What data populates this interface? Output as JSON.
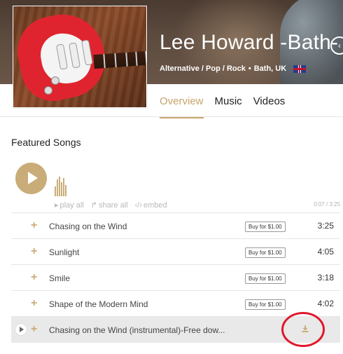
{
  "artist": {
    "name": "Lee Howard -Bath-",
    "genres": "Alternative / Pop / Rock",
    "separator": "•",
    "location": "Bath, UK"
  },
  "tabs": [
    {
      "label": "Overview",
      "active": true
    },
    {
      "label": "Music",
      "active": false
    },
    {
      "label": "Videos",
      "active": false
    }
  ],
  "featured": {
    "title": "Featured Songs",
    "actions": {
      "play_all": "play all",
      "share_all": "share all",
      "embed": "embed"
    },
    "time_display": "0:07 / 3:25"
  },
  "songs": [
    {
      "title": "Chasing on the Wind",
      "buy_label": "Buy for $1.00",
      "duration": "3:25"
    },
    {
      "title": "Sunlight",
      "buy_label": "Buy for $1.00",
      "duration": "4:05"
    },
    {
      "title": "Smile",
      "buy_label": "Buy for $1.00",
      "duration": "3:18"
    },
    {
      "title": "Shape of the Modern Mind",
      "buy_label": "Buy for $1.00",
      "duration": "4:02"
    },
    {
      "title": "Chasing on the Wind (instrumental)-Free dow...",
      "download_icon": "download-icon"
    }
  ],
  "colors": {
    "accent": "#c9ac78",
    "highlight_circle": "#e0182a"
  }
}
